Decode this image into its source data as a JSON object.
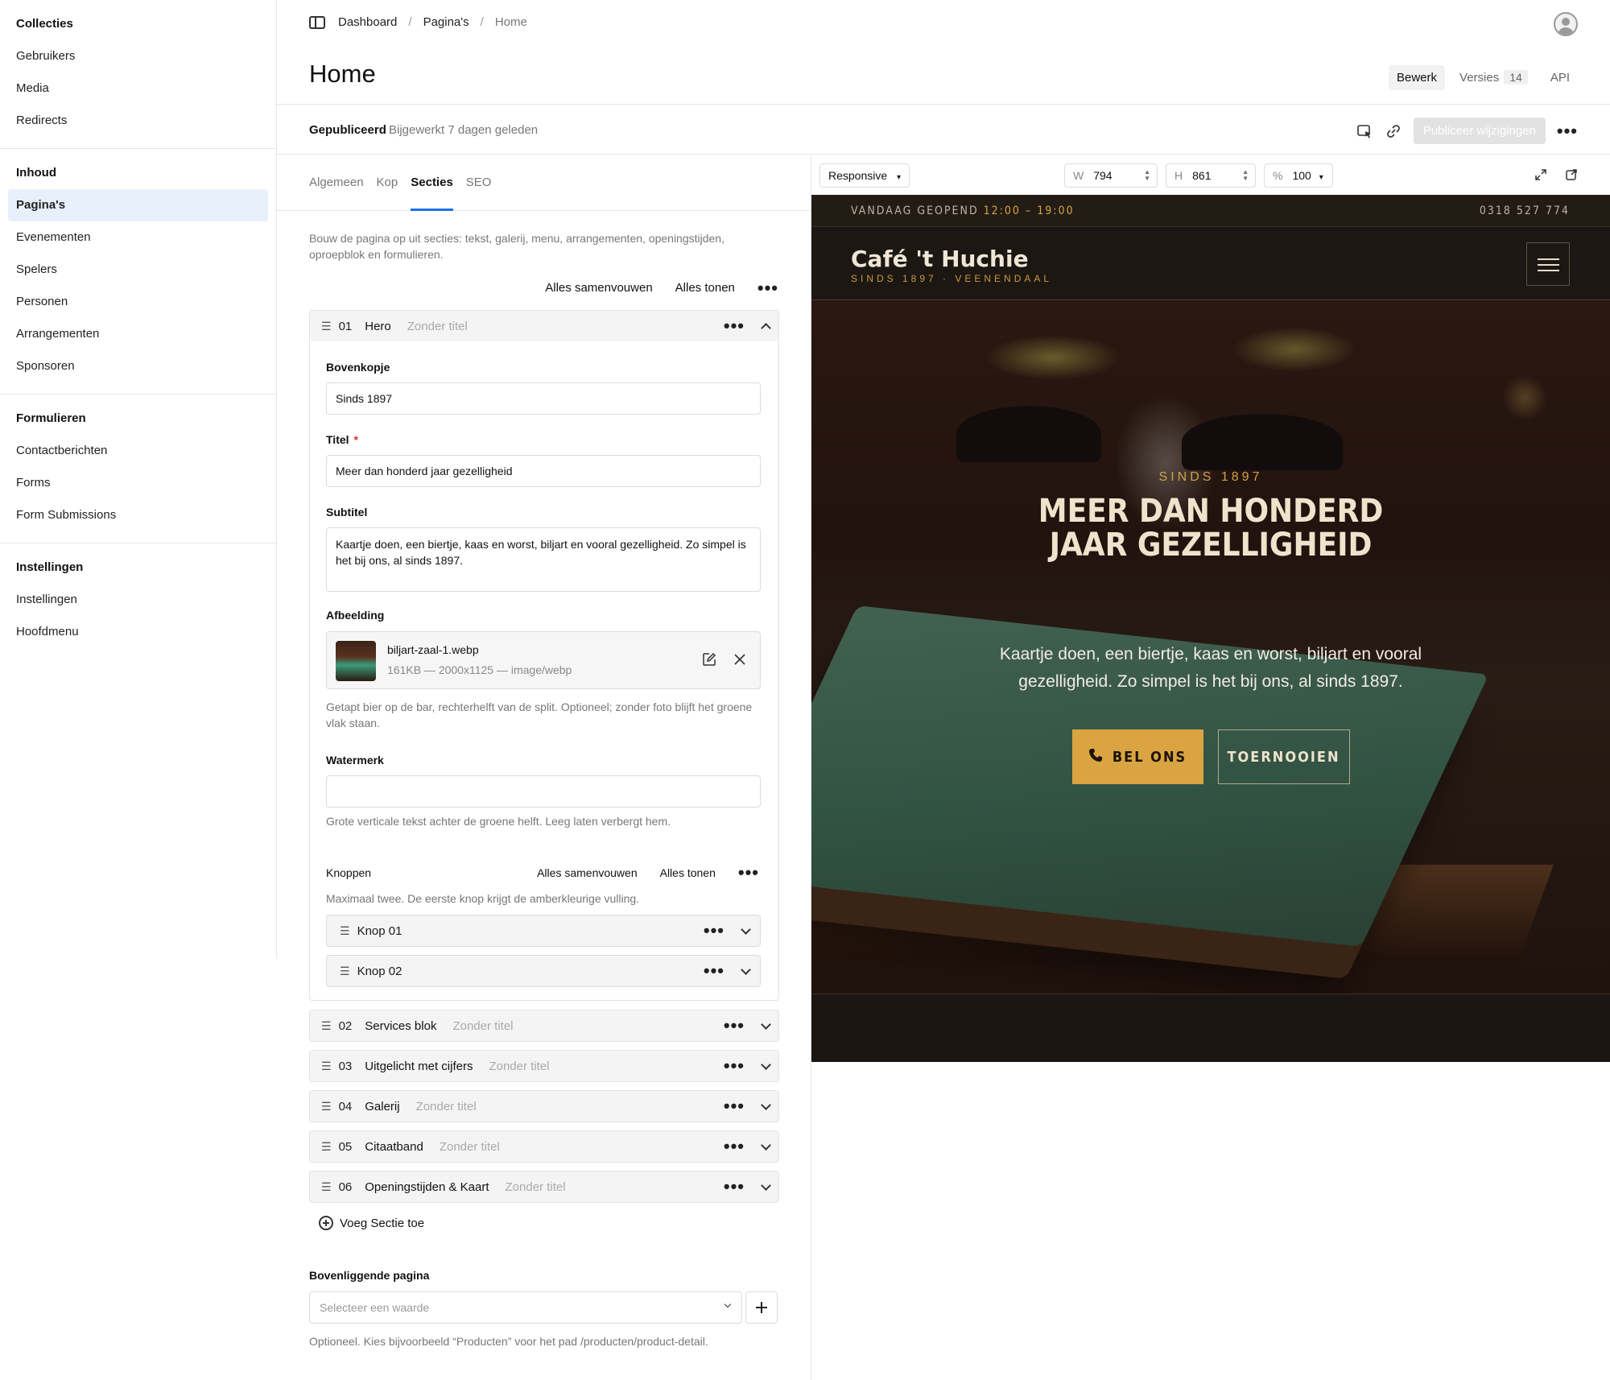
{
  "sidebar": {
    "groups": [
      {
        "heading": "Collecties",
        "items": [
          "Gebruikers",
          "Media",
          "Redirects"
        ]
      },
      {
        "heading": "Inhoud",
        "items": [
          "Pagina's",
          "Evenementen",
          "Spelers",
          "Personen",
          "Arrangementen",
          "Sponsoren"
        ]
      },
      {
        "heading": "Formulieren",
        "items": [
          "Contactberichten",
          "Forms",
          "Form Submissions"
        ]
      },
      {
        "heading": "Instellingen",
        "items": [
          "Instellingen",
          "Hoofdmenu"
        ]
      }
    ],
    "active_item": "Pagina's"
  },
  "breadcrumb": {
    "items": [
      "Dashboard",
      "Pagina's",
      "Home"
    ]
  },
  "page_title": "Home",
  "header_tabs": {
    "edit": "Bewerk",
    "versions": "Versies",
    "versions_count": "14",
    "api": "API"
  },
  "status": {
    "label": "Gepubliceerd",
    "meta": "Bijgewerkt 7 dagen geleden",
    "publish_button": "Publiceer wijzigingen"
  },
  "editor": {
    "tabs": [
      "Algemeen",
      "Kop",
      "Secties",
      "SEO"
    ],
    "active_tab": "Secties",
    "intro": "Bouw de pagina op uit secties: tekst, galerij, menu, arrangementen, openingstijden, oproepblok en formulieren.",
    "collapse_all": "Alles samenvouwen",
    "show_all": "Alles tonen",
    "hero_block": {
      "num": "01",
      "type": "Hero",
      "subtitle": "Zonder titel",
      "eyebrow_label": "Bovenkopje",
      "eyebrow_value": "Sinds 1897",
      "title_label": "Titel",
      "title_required": "*",
      "title_value": "Meer dan honderd jaar gezelligheid",
      "subtitle_label": "Subtitel",
      "subtitle_value": "Kaartje doen, een biertje, kaas en worst, biljart en vooral gezelligheid. Zo simpel is het bij ons, al sinds 1897.",
      "image_label": "Afbeelding",
      "image_name": "biljart-zaal-1.webp",
      "image_meta": "161KB — 2000x1125 — image/webp",
      "image_help": "Getapt bier op de bar, rechterhelft van de split. Optioneel; zonder foto blijft het groene vlak staan.",
      "watermark_label": "Watermerk",
      "watermark_value": "",
      "watermark_help": "Grote verticale tekst achter de groene helft. Leeg laten verbergt hem.",
      "buttons_label": "Knoppen",
      "buttons_collapse": "Alles samenvouwen",
      "buttons_show": "Alles tonen",
      "buttons_help": "Maximaal twee. De eerste knop krijgt de amberkleurige vulling.",
      "button_items": [
        "Knop 01",
        "Knop 02"
      ]
    },
    "other_blocks": [
      {
        "num": "02",
        "type": "Services blok",
        "subtitle": "Zonder titel"
      },
      {
        "num": "03",
        "type": "Uitgelicht met cijfers",
        "subtitle": "Zonder titel"
      },
      {
        "num": "04",
        "type": "Galerij",
        "subtitle": "Zonder titel"
      },
      {
        "num": "05",
        "type": "Citaatband",
        "subtitle": "Zonder titel"
      },
      {
        "num": "06",
        "type": "Openingstijden & Kaart",
        "subtitle": "Zonder titel"
      }
    ],
    "add_section": "Voeg Sectie toe",
    "parent_label": "Bovenliggende pagina",
    "parent_placeholder": "Selecteer een waarde",
    "parent_help": "Optioneel. Kies bijvoorbeeld “Producten” voor het pad /producten/product-detail."
  },
  "preview_toolbar": {
    "mode": "Responsive",
    "width_label": "W",
    "width": "794",
    "height_label": "H",
    "height": "861",
    "zoom_label": "%",
    "zoom": "100"
  },
  "site": {
    "topbar_open": "VANDAAG GEOPEND",
    "topbar_hours": "12:00 – 19:00",
    "topbar_phone": "0318 527 774",
    "brand": "Café 't Huchie",
    "brand_sub": "SINDS 1897 · VEENENDAAL",
    "hero_eyebrow": "SINDS 1897",
    "hero_title": "MEER DAN HONDERD JAAR GEZELLIGHEID",
    "hero_sub": "Kaartje doen, een biertje, kaas en worst, biljart en vooral gezelligheid. Zo simpel is het bij ons, al sinds 1897.",
    "btn_primary": "BEL ONS",
    "btn_secondary": "TOERNOOIEN",
    "accent": "#d9a441"
  }
}
